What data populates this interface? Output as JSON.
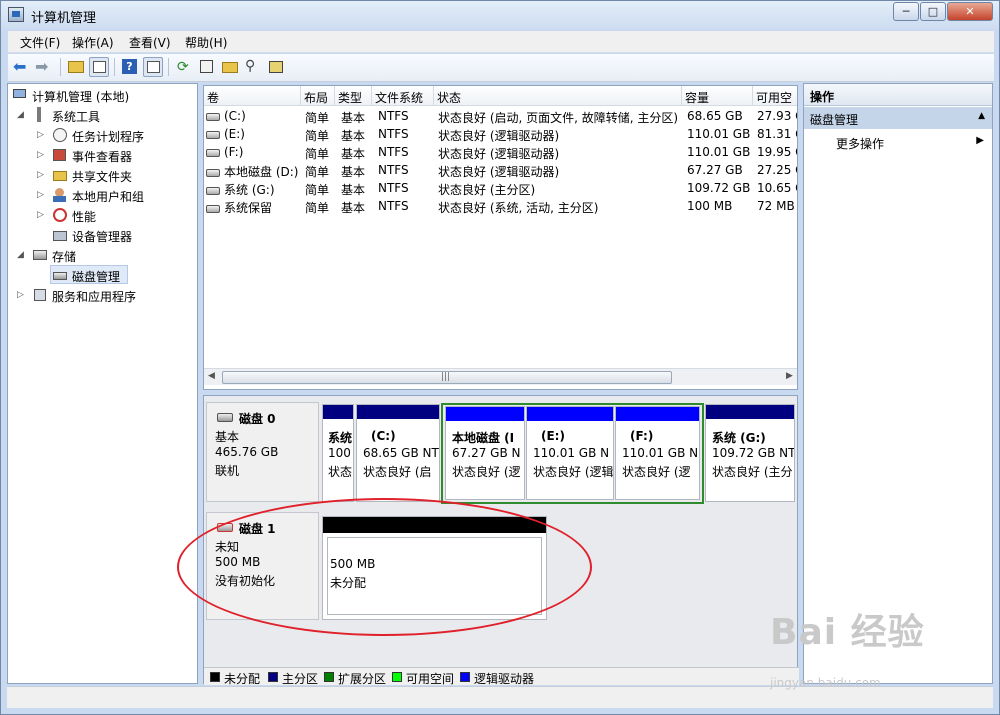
{
  "window": {
    "title": "计算机管理"
  },
  "menu": [
    "文件(F)",
    "操作(A)",
    "查看(V)",
    "帮助(H)"
  ],
  "tree": {
    "root": "计算机管理 (本地)",
    "system_tools": "系统工具",
    "task_scheduler": "任务计划程序",
    "event_viewer": "事件查看器",
    "shared_folders": "共享文件夹",
    "local_users": "本地用户和组",
    "performance": "性能",
    "device_manager": "设备管理器",
    "storage": "存储",
    "disk_management": "磁盘管理",
    "services_apps": "服务和应用程序"
  },
  "volume_list": {
    "headers": [
      "卷",
      "布局",
      "类型",
      "文件系统",
      "状态",
      "容量",
      "可用空"
    ],
    "rows": [
      {
        "vol": "(C:)",
        "layout": "简单",
        "type": "基本",
        "fs": "NTFS",
        "status": "状态良好 (启动, 页面文件, 故障转储, 主分区)",
        "cap": "68.65 GB",
        "free": "27.93 G"
      },
      {
        "vol": "(E:)",
        "layout": "简单",
        "type": "基本",
        "fs": "NTFS",
        "status": "状态良好 (逻辑驱动器)",
        "cap": "110.01 GB",
        "free": "81.31 G"
      },
      {
        "vol": "(F:)",
        "layout": "简单",
        "type": "基本",
        "fs": "NTFS",
        "status": "状态良好 (逻辑驱动器)",
        "cap": "110.01 GB",
        "free": "19.95 G"
      },
      {
        "vol": "本地磁盘 (D:)",
        "layout": "简单",
        "type": "基本",
        "fs": "NTFS",
        "status": "状态良好 (逻辑驱动器)",
        "cap": "67.27 GB",
        "free": "27.25 G"
      },
      {
        "vol": "系统 (G:)",
        "layout": "简单",
        "type": "基本",
        "fs": "NTFS",
        "status": "状态良好 (主分区)",
        "cap": "109.72 GB",
        "free": "10.65 G"
      },
      {
        "vol": "系统保留",
        "layout": "简单",
        "type": "基本",
        "fs": "NTFS",
        "status": "状态良好 (系统, 活动, 主分区)",
        "cap": "100 MB",
        "free": "72 MB"
      }
    ]
  },
  "disk0": {
    "name": "磁盘 0",
    "type": "基本",
    "size": "465.76 GB",
    "state": "联机",
    "partitions": [
      {
        "name": "系统",
        "size": "100",
        "status": "状态"
      },
      {
        "name": "(C:)",
        "size": "68.65 GB NT",
        "status": "状态良好 (启"
      },
      {
        "name": "本地磁盘 (I",
        "size": "67.27 GB N",
        "status": "状态良好 (逻"
      },
      {
        "name": "(E:)",
        "size": "110.01 GB N",
        "status": "状态良好 (逻辑"
      },
      {
        "name": "(F:)",
        "size": "110.01 GB N",
        "status": "状态良好 (逻"
      },
      {
        "name": "系统 (G:)",
        "size": "109.72 GB NT",
        "status": "状态良好 (主分"
      }
    ]
  },
  "disk1": {
    "name": "磁盘 1",
    "type": "未知",
    "size": "500 MB",
    "state": "没有初始化",
    "partition": {
      "size": "500 MB",
      "status": "未分配"
    }
  },
  "legend": [
    "未分配",
    "主分区",
    "扩展分区",
    "可用空间",
    "逻辑驱动器"
  ],
  "colors": {
    "unallocated": "#000000",
    "primary": "#000080",
    "extended": "#008000",
    "free": "#00ff00",
    "logical": "#0000ff"
  },
  "actions": {
    "header": "操作",
    "section": "磁盘管理",
    "more": "更多操作"
  },
  "watermark": {
    "brand": "Bai 经验",
    "url": "jingyan.baidu.com"
  }
}
